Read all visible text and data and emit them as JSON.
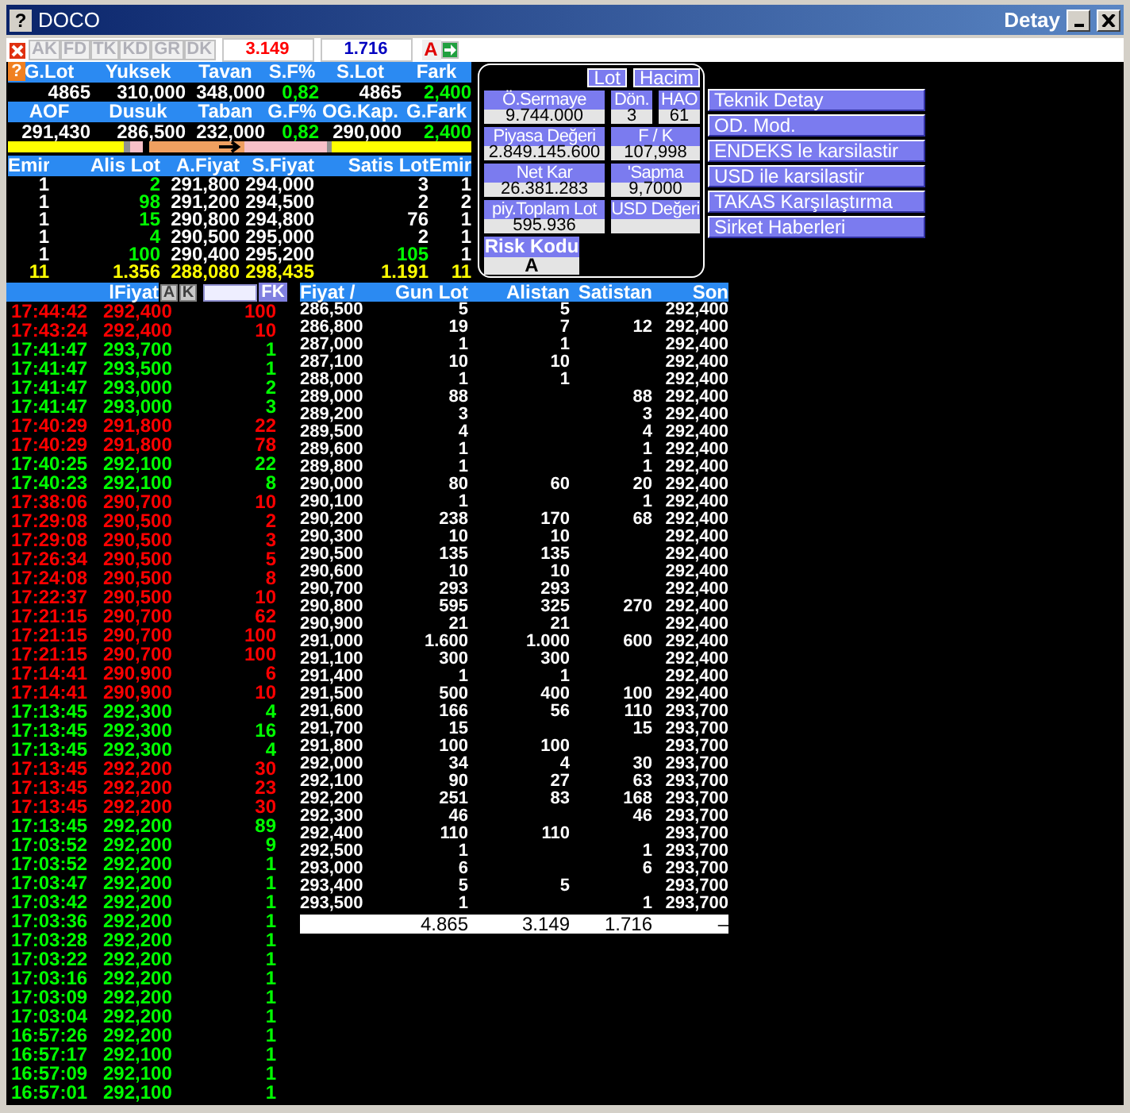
{
  "window": {
    "icon": "?",
    "title": "DOCO",
    "right_title": "Detay"
  },
  "toolbar": {
    "tabs": [
      {
        "label": "AK",
        "disabled": true
      },
      {
        "label": "FD",
        "disabled": true
      },
      {
        "label": "TK",
        "disabled": true
      },
      {
        "label": "KD",
        "disabled": true
      },
      {
        "label": "GR",
        "disabled": true
      },
      {
        "label": "DK",
        "disabled": true
      }
    ],
    "fields": [
      {
        "value": "3.149",
        "color": "#ff0000"
      },
      {
        "value": "1.716",
        "color": "#0000c0"
      }
    ],
    "mode": "A"
  },
  "stats": {
    "help_icon": "?",
    "items": [
      {
        "label": "G.Lot",
        "value": "4865",
        "kind": "plain"
      },
      {
        "label": "Yuksek",
        "value": "310,000",
        "kind": "plain"
      },
      {
        "label": "Tavan",
        "value": "348,000",
        "kind": "plain"
      },
      {
        "label": "S.F%",
        "value": "0,82",
        "kind": "change"
      },
      {
        "label": "S.Lot",
        "value": "4865",
        "kind": "plain"
      },
      {
        "label": "Fark",
        "value": "2,400",
        "kind": "change"
      },
      {
        "label": "AOF",
        "value": "291,430",
        "kind": "plain"
      },
      {
        "label": "Dusuk",
        "value": "286,500",
        "kind": "plain"
      },
      {
        "label": "Taban",
        "value": "232,000",
        "kind": "plain"
      },
      {
        "label": "G.F%",
        "value": "0,82",
        "kind": "change"
      },
      {
        "label": "OG.Kap.",
        "value": "290,000",
        "kind": "plain"
      },
      {
        "label": "G.Fark",
        "value": "2,400",
        "kind": "change"
      }
    ]
  },
  "order_book": {
    "columns": [
      "Emir",
      "Alis Lot",
      "A.Fiyat",
      "S.Fiyat",
      "Satis Lot",
      "Emir"
    ],
    "rows": [
      {
        "cells": [
          "1",
          "2",
          "291,800",
          "294,000",
          "3",
          "1"
        ],
        "color": "#ffffff"
      },
      {
        "cells": [
          "1",
          "98",
          "291,200",
          "294,500",
          "2",
          "2"
        ],
        "color": "#ffffff"
      },
      {
        "cells": [
          "1",
          "15",
          "290,800",
          "294,800",
          "76",
          "1"
        ],
        "color": "#ffffff"
      },
      {
        "cells": [
          "1",
          "4",
          "290,500",
          "295,000",
          "2",
          "1"
        ],
        "color": "#ffffff"
      },
      {
        "cells": [
          "1",
          "100",
          "290,400",
          "295,200",
          "105",
          "1"
        ],
        "color": "#00ff00"
      }
    ],
    "total": [
      "11",
      "1.356",
      "288,080",
      "298,435",
      "1.191",
      "11"
    ]
  },
  "detail_panel": {
    "toggles": [
      "Lot",
      "Hacim"
    ],
    "rows": [
      [
        {
          "label": "Ö.Sermaye",
          "value": "9.744.000"
        },
        {
          "label": "Dön.",
          "value": "3"
        },
        {
          "label": "HAO",
          "value": "61"
        }
      ],
      [
        {
          "label": "Piyasa Değeri",
          "value": "2.849.145.600"
        },
        {
          "label": "F / K",
          "value": "107,998"
        }
      ],
      [
        {
          "label": "Net Kar",
          "value": "26.381.283"
        },
        {
          "label": "'Sapma",
          "value": "9,7000"
        }
      ],
      [
        {
          "label": "piy.Toplam Lot",
          "value": "595.936"
        },
        {
          "label": "USD Değeri"
        }
      ]
    ],
    "risk": {
      "label": "Risk Kodu",
      "value": "A"
    }
  },
  "actions": [
    "Teknik Detay",
    "OD. Mod.",
    "ENDEKS le karsilastir",
    "USD ile karsilastir",
    "TAKAS Karşılaştırma",
    "Sirket Haberleri"
  ],
  "trades": {
    "header": "lFiyat",
    "buttons": [
      "A",
      "K"
    ],
    "filter_button": "FK",
    "rows": [
      {
        "time": "17:44:42",
        "price": "292,400",
        "lot": "100",
        "color": "#ff0000"
      },
      {
        "time": "17:43:24",
        "price": "292,400",
        "lot": "10",
        "color": "#ff0000"
      },
      {
        "time": "17:41:47",
        "price": "293,700",
        "lot": "1",
        "color": "#00ff00"
      },
      {
        "time": "17:41:47",
        "price": "293,500",
        "lot": "1",
        "color": "#00ff00"
      },
      {
        "time": "17:41:47",
        "price": "293,000",
        "lot": "2",
        "color": "#00ff00"
      },
      {
        "time": "17:41:47",
        "price": "293,000",
        "lot": "3",
        "color": "#00ff00"
      },
      {
        "time": "17:40:29",
        "price": "291,800",
        "lot": "22",
        "color": "#ff0000"
      },
      {
        "time": "17:40:29",
        "price": "291,800",
        "lot": "78",
        "color": "#ff0000"
      },
      {
        "time": "17:40:25",
        "price": "292,100",
        "lot": "22",
        "color": "#00ff00"
      },
      {
        "time": "17:40:23",
        "price": "292,100",
        "lot": "8",
        "color": "#00ff00"
      },
      {
        "time": "17:38:06",
        "price": "290,700",
        "lot": "10",
        "color": "#ff0000"
      },
      {
        "time": "17:29:08",
        "price": "290,500",
        "lot": "2",
        "color": "#ff0000"
      },
      {
        "time": "17:29:08",
        "price": "290,500",
        "lot": "3",
        "color": "#ff0000"
      },
      {
        "time": "17:26:34",
        "price": "290,500",
        "lot": "5",
        "color": "#ff0000"
      },
      {
        "time": "17:24:08",
        "price": "290,500",
        "lot": "8",
        "color": "#ff0000"
      },
      {
        "time": "17:22:37",
        "price": "290,500",
        "lot": "10",
        "color": "#ff0000"
      },
      {
        "time": "17:21:15",
        "price": "290,700",
        "lot": "62",
        "color": "#ff0000"
      },
      {
        "time": "17:21:15",
        "price": "290,700",
        "lot": "100",
        "color": "#ff0000"
      },
      {
        "time": "17:21:15",
        "price": "290,700",
        "lot": "100",
        "color": "#ff0000"
      },
      {
        "time": "17:14:41",
        "price": "290,900",
        "lot": "6",
        "color": "#ff0000"
      },
      {
        "time": "17:14:41",
        "price": "290,900",
        "lot": "10",
        "color": "#ff0000"
      },
      {
        "time": "17:13:45",
        "price": "292,300",
        "lot": "4",
        "color": "#00ff00"
      },
      {
        "time": "17:13:45",
        "price": "292,300",
        "lot": "16",
        "color": "#00ff00"
      },
      {
        "time": "17:13:45",
        "price": "292,300",
        "lot": "4",
        "color": "#00ff00"
      },
      {
        "time": "17:13:45",
        "price": "292,200",
        "lot": "30",
        "color": "#ff0000"
      },
      {
        "time": "17:13:45",
        "price": "292,200",
        "lot": "23",
        "color": "#ff0000"
      },
      {
        "time": "17:13:45",
        "price": "292,200",
        "lot": "30",
        "color": "#ff0000"
      },
      {
        "time": "17:13:45",
        "price": "292,200",
        "lot": "89",
        "color": "#00ff00"
      },
      {
        "time": "17:03:52",
        "price": "292,200",
        "lot": "9",
        "color": "#00ff00"
      },
      {
        "time": "17:03:52",
        "price": "292,200",
        "lot": "1",
        "color": "#00ff00"
      },
      {
        "time": "17:03:47",
        "price": "292,200",
        "lot": "1",
        "color": "#00ff00"
      },
      {
        "time": "17:03:42",
        "price": "292,200",
        "lot": "1",
        "color": "#00ff00"
      },
      {
        "time": "17:03:36",
        "price": "292,200",
        "lot": "1",
        "color": "#00ff00"
      },
      {
        "time": "17:03:28",
        "price": "292,200",
        "lot": "1",
        "color": "#00ff00"
      },
      {
        "time": "17:03:22",
        "price": "292,200",
        "lot": "1",
        "color": "#00ff00"
      },
      {
        "time": "17:03:16",
        "price": "292,200",
        "lot": "1",
        "color": "#00ff00"
      },
      {
        "time": "17:03:09",
        "price": "292,200",
        "lot": "1",
        "color": "#00ff00"
      },
      {
        "time": "17:03:04",
        "price": "292,200",
        "lot": "1",
        "color": "#00ff00"
      },
      {
        "time": "16:57:26",
        "price": "292,200",
        "lot": "1",
        "color": "#00ff00"
      },
      {
        "time": "16:57:17",
        "price": "292,100",
        "lot": "1",
        "color": "#00ff00"
      },
      {
        "time": "16:57:09",
        "price": "292,100",
        "lot": "1",
        "color": "#00ff00"
      },
      {
        "time": "16:57:01",
        "price": "292,100",
        "lot": "1",
        "color": "#00ff00"
      }
    ]
  },
  "price_table": {
    "columns": [
      "Fiyat /",
      "Gun Lot",
      "Alistan",
      "Satistan",
      "Son"
    ],
    "rows": [
      {
        "fiyat": "286,500",
        "gun_lot": "5",
        "alistan": "5",
        "son": "292,400"
      },
      {
        "fiyat": "286,800",
        "gun_lot": "19",
        "alistan": "7",
        "satistan": "12",
        "son": "292,400"
      },
      {
        "fiyat": "287,000",
        "gun_lot": "1",
        "alistan": "1",
        "son": "292,400"
      },
      {
        "fiyat": "287,100",
        "gun_lot": "10",
        "alistan": "10",
        "son": "292,400"
      },
      {
        "fiyat": "288,000",
        "gun_lot": "1",
        "alistan": "1",
        "son": "292,400"
      },
      {
        "fiyat": "289,000",
        "gun_lot": "88",
        "satistan": "88",
        "son": "292,400"
      },
      {
        "fiyat": "289,200",
        "gun_lot": "3",
        "satistan": "3",
        "son": "292,400"
      },
      {
        "fiyat": "289,500",
        "gun_lot": "4",
        "satistan": "4",
        "son": "292,400"
      },
      {
        "fiyat": "289,600",
        "gun_lot": "1",
        "satistan": "1",
        "son": "292,400"
      },
      {
        "fiyat": "289,800",
        "gun_lot": "1",
        "satistan": "1",
        "son": "292,400"
      },
      {
        "fiyat": "290,000",
        "gun_lot": "80",
        "alistan": "60",
        "satistan": "20",
        "son": "292,400"
      },
      {
        "fiyat": "290,100",
        "gun_lot": "1",
        "satistan": "1",
        "son": "292,400"
      },
      {
        "fiyat": "290,200",
        "gun_lot": "238",
        "alistan": "170",
        "satistan": "68",
        "son": "292,400"
      },
      {
        "fiyat": "290,300",
        "gun_lot": "10",
        "alistan": "10",
        "son": "292,400"
      },
      {
        "fiyat": "290,500",
        "gun_lot": "135",
        "alistan": "135",
        "son": "292,400"
      },
      {
        "fiyat": "290,600",
        "gun_lot": "10",
        "alistan": "10",
        "son": "292,400"
      },
      {
        "fiyat": "290,700",
        "gun_lot": "293",
        "alistan": "293",
        "son": "292,400"
      },
      {
        "fiyat": "290,800",
        "gun_lot": "595",
        "alistan": "325",
        "satistan": "270",
        "son": "292,400"
      },
      {
        "fiyat": "290,900",
        "gun_lot": "21",
        "alistan": "21",
        "son": "292,400"
      },
      {
        "fiyat": "291,000",
        "gun_lot": "1.600",
        "alistan": "1.000",
        "satistan": "600",
        "son": "292,400"
      },
      {
        "fiyat": "291,100",
        "gun_lot": "300",
        "alistan": "300",
        "son": "292,400"
      },
      {
        "fiyat": "291,400",
        "gun_lot": "1",
        "alistan": "1",
        "son": "292,400"
      },
      {
        "fiyat": "291,500",
        "gun_lot": "500",
        "alistan": "400",
        "satistan": "100",
        "son": "292,400"
      },
      {
        "fiyat": "291,600",
        "gun_lot": "166",
        "alistan": "56",
        "satistan": "110",
        "son": "293,700"
      },
      {
        "fiyat": "291,700",
        "gun_lot": "15",
        "satistan": "15",
        "son": "293,700"
      },
      {
        "fiyat": "291,800",
        "gun_lot": "100",
        "alistan": "100",
        "son": "293,700"
      },
      {
        "fiyat": "292,000",
        "gun_lot": "34",
        "alistan": "4",
        "satistan": "30",
        "son": "293,700"
      },
      {
        "fiyat": "292,100",
        "gun_lot": "90",
        "alistan": "27",
        "satistan": "63",
        "son": "293,700"
      },
      {
        "fiyat": "292,200",
        "gun_lot": "251",
        "alistan": "83",
        "satistan": "168",
        "son": "293,700"
      },
      {
        "fiyat": "292,300",
        "gun_lot": "46",
        "satistan": "46",
        "son": "293,700"
      },
      {
        "fiyat": "292,400",
        "gun_lot": "110",
        "alistan": "110",
        "son": "293,700"
      },
      {
        "fiyat": "292,500",
        "gun_lot": "1",
        "satistan": "1",
        "son": "293,700"
      },
      {
        "fiyat": "293,000",
        "gun_lot": "6",
        "satistan": "6",
        "son": "293,700"
      },
      {
        "fiyat": "293,400",
        "gun_lot": "5",
        "alistan": "5",
        "son": "293,700"
      },
      {
        "fiyat": "293,500",
        "gun_lot": "1",
        "satistan": "1",
        "son": "293,700"
      }
    ],
    "total": {
      "gun_lot": "4.865",
      "alistan": "3.149",
      "satistan": "1.716",
      "son": "–"
    }
  }
}
